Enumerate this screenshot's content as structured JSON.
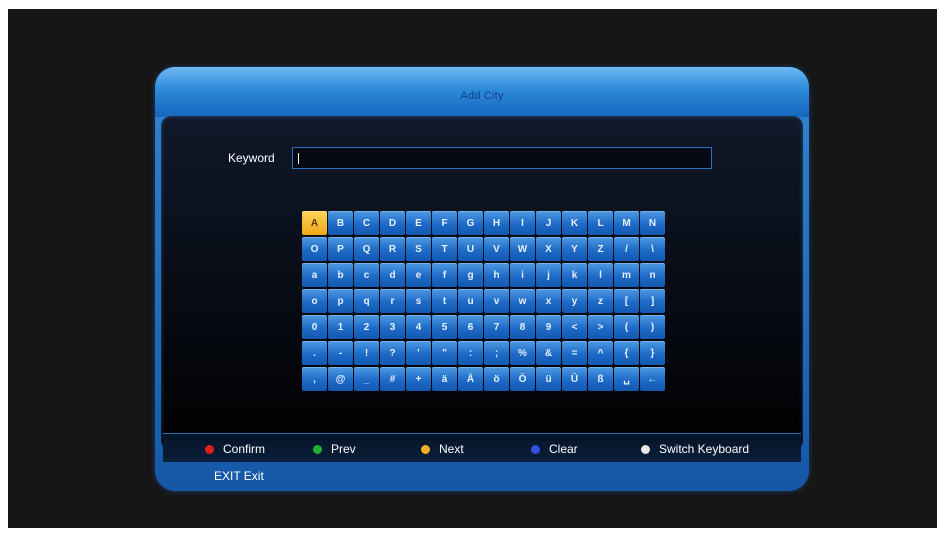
{
  "dialog": {
    "title": "Add City"
  },
  "keyword": {
    "label": "Keyword",
    "value": ""
  },
  "keyboard": {
    "rows": [
      [
        "A",
        "B",
        "C",
        "D",
        "E",
        "F",
        "G",
        "H",
        "I",
        "J",
        "K",
        "L",
        "M",
        "N"
      ],
      [
        "O",
        "P",
        "Q",
        "R",
        "S",
        "T",
        "U",
        "V",
        "W",
        "X",
        "Y",
        "Z",
        "/",
        "\\"
      ],
      [
        "a",
        "b",
        "c",
        "d",
        "e",
        "f",
        "g",
        "h",
        "i",
        "j",
        "k",
        "l",
        "m",
        "n"
      ],
      [
        "o",
        "p",
        "q",
        "r",
        "s",
        "t",
        "u",
        "v",
        "w",
        "x",
        "y",
        "z",
        "[",
        "]"
      ],
      [
        "0",
        "1",
        "2",
        "3",
        "4",
        "5",
        "6",
        "7",
        "8",
        "9",
        "<",
        ">",
        "(",
        ")"
      ],
      [
        ".",
        "-",
        "!",
        "?",
        "'",
        "\"",
        ":",
        ";",
        "%",
        "&",
        "=",
        "^",
        "{",
        "}"
      ],
      [
        ",",
        "@",
        "_",
        "#",
        "+",
        "ä",
        "Ä",
        "ö",
        "Ö",
        "ü",
        "Ü",
        "ß",
        "␣",
        "←"
      ]
    ],
    "selected": "A"
  },
  "legend": [
    {
      "label": "Confirm",
      "color": "#e02020"
    },
    {
      "label": "Prev",
      "color": "#20b030"
    },
    {
      "label": "Next",
      "color": "#f0b020"
    },
    {
      "label": "Clear",
      "color": "#3050e0"
    },
    {
      "label": "Switch Keyboard",
      "color": "#e8e8e8"
    }
  ],
  "exit": "EXIT Exit"
}
